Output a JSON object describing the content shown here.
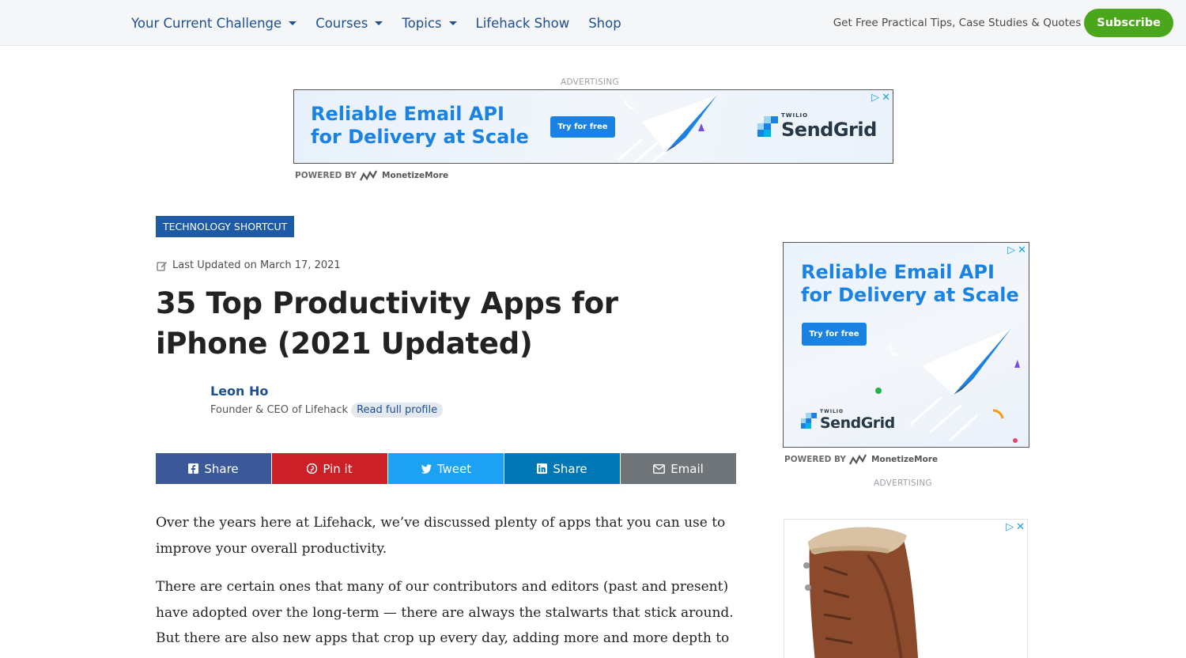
{
  "nav": {
    "items": [
      {
        "label": "Your Current Challenge",
        "dropdown": true
      },
      {
        "label": "Courses",
        "dropdown": true
      },
      {
        "label": "Topics",
        "dropdown": true
      },
      {
        "label": "Lifehack Show",
        "dropdown": false
      },
      {
        "label": "Shop",
        "dropdown": false
      }
    ],
    "tagline": "Get Free Practical Tips, Case Studies & Quotes",
    "subscribe_label": "Subscribe"
  },
  "top_ad": {
    "label": "ADVERTISING",
    "headline_line1": "Reliable Email API",
    "headline_line2": "for Delivery at Scale",
    "cta": "Try for free",
    "brand_prefix": "TWILIO",
    "brand_name": "SendGrid",
    "powered_by": "POWERED BY",
    "powered_name": "MonetizeMore"
  },
  "side_ad": {
    "headline_line1": "Reliable Email API",
    "headline_line2": "for Delivery at Scale",
    "cta": "Try for free",
    "brand_prefix": "TWILIO",
    "brand_name": "SendGrid",
    "powered_by": "POWERED BY",
    "powered_name": "MonetizeMore",
    "label": "ADVERTISING"
  },
  "article": {
    "category": "TECHNOLOGY SHORTCUT",
    "updated": "Last Updated on March 17, 2021",
    "title": "35 Top Productivity Apps for iPhone (2021 Updated)",
    "author": {
      "name": "Leon Ho",
      "role": "Founder & CEO of Lifehack",
      "profile_link": "Read full profile"
    },
    "share": [
      {
        "label": "Share",
        "icon": "facebook-icon",
        "color": "#3b5998"
      },
      {
        "label": "Pin it",
        "icon": "pinterest-icon",
        "color": "#cb2027"
      },
      {
        "label": "Tweet",
        "icon": "twitter-icon",
        "color": "#1da1f2"
      },
      {
        "label": "Share",
        "icon": "linkedin-icon",
        "color": "#0077b5"
      },
      {
        "label": "Email",
        "icon": "email-icon",
        "color": "#6f7478"
      }
    ],
    "paragraphs": [
      "Over the years here at Lifehack, we’ve discussed plenty of apps that you can use to improve your overall productivity.",
      "There are certain ones that many of our contributors and editors (past and present) have adopted over the long-term — there are always the stalwarts that stick around. But there are also new apps that crop up every day, adding more and more depth to the app category."
    ]
  },
  "colors": {
    "nav_link": "#1d4f91",
    "subscribe": "#4aa61b",
    "category_tag": "#1d5ba6",
    "ad_blue": "#1a82e2"
  }
}
